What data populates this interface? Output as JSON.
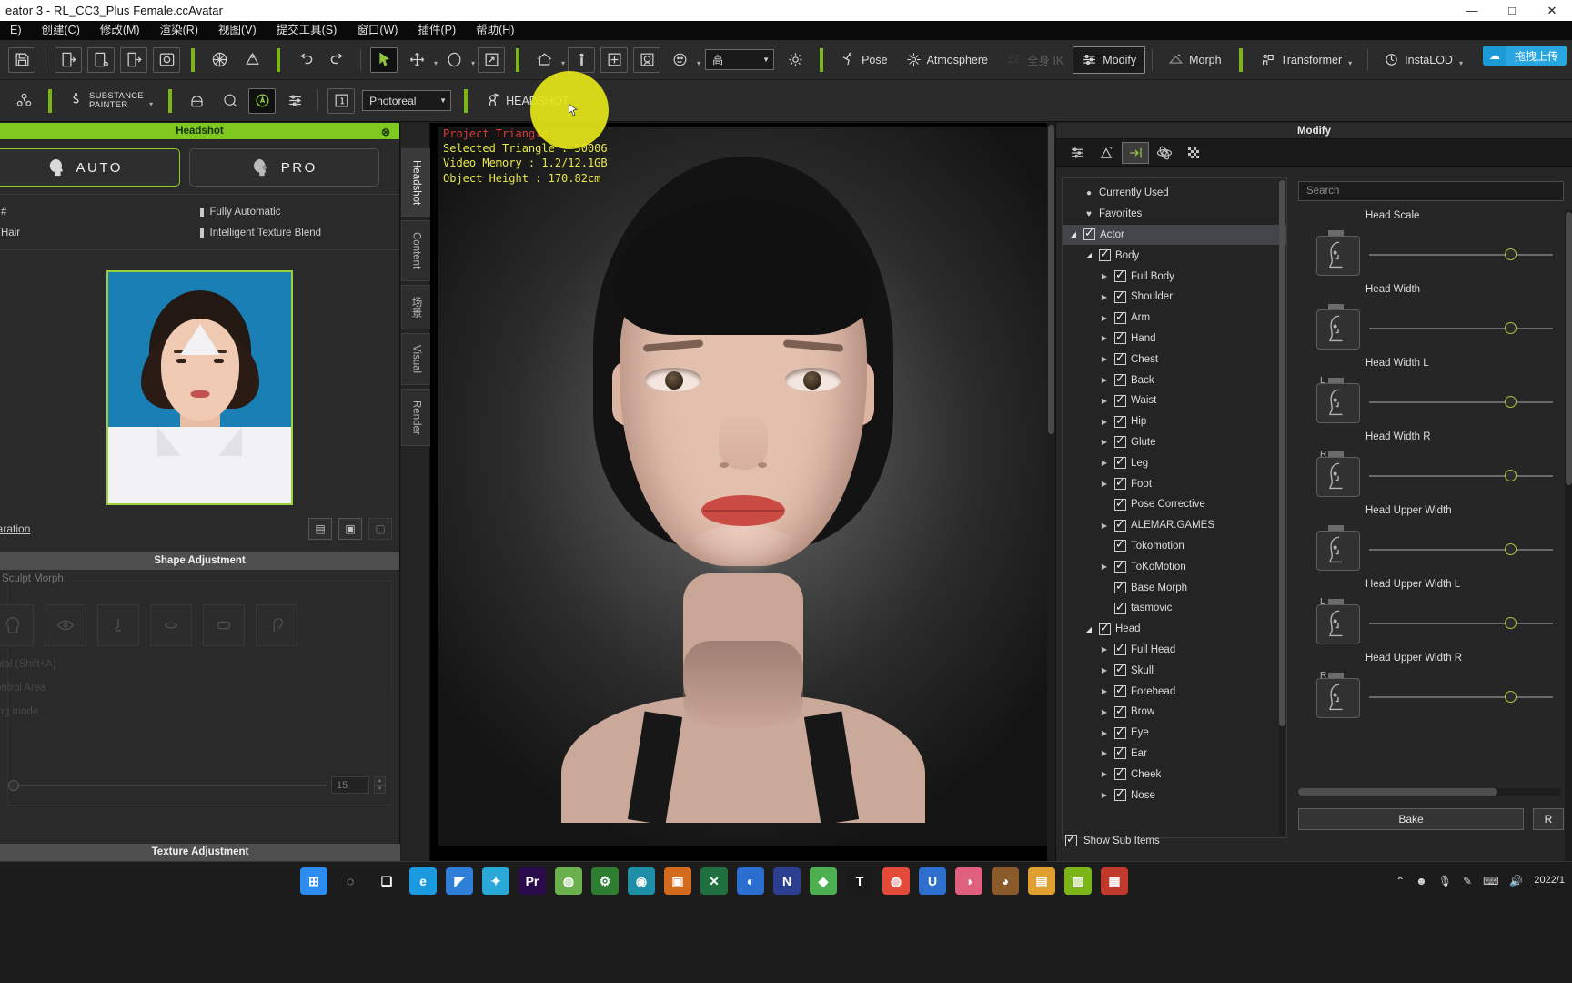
{
  "window": {
    "title": "eator 3 - RL_CC3_Plus Female.ccAvatar",
    "minimize": "—",
    "maximize": "□",
    "close": "✕"
  },
  "menubar": {
    "items": [
      {
        "label": "E)"
      },
      {
        "label": "创建(C)"
      },
      {
        "label": "修改(M)"
      },
      {
        "label": "渲染(R)"
      },
      {
        "label": "视图(V)"
      },
      {
        "label": "提交工具(S)"
      },
      {
        "label": "窗口(W)"
      },
      {
        "label": "插件(P)"
      },
      {
        "label": "帮助(H)"
      }
    ]
  },
  "upload_pill": {
    "icon": "cloud-icon",
    "label": "拖拽上传"
  },
  "toolbar_row1": {
    "save": "save-icon",
    "import_avatar": "import-avatar-icon",
    "import_prop": "import-prop-icon",
    "export": "export-icon",
    "preview": "preview-icon",
    "geometry": "geometry-icon",
    "mesh": "mesh-icon",
    "undo": "undo-icon",
    "redo": "redo-icon",
    "select": "select-arrow-icon",
    "move": "move-icon",
    "rotate": "rotate-icon",
    "scale": "scale-icon",
    "home": "home-icon",
    "fit_person": "fit-person-icon",
    "fit_all": "fit-all-icon",
    "face_view": "face-view-icon",
    "expression": "expression-icon",
    "quality_value": "高",
    "light": "light-icon",
    "pose_label": "Pose",
    "atmosphere_label": "Atmosphere",
    "disabled_label": "全身 IK",
    "modify_label": "Modify",
    "morph_label": "Morph",
    "transformer_label": "Transformer",
    "instalod_label": "InstaLOD"
  },
  "toolbar_row2": {
    "character_icon": "character-creator-icon",
    "substance_brand_top": "SUBSTANCE",
    "substance_brand_bottom": "PAINTER",
    "smart_hair": "smart-hair-icon",
    "skingen": "skingen-icon",
    "appearance": "appearance-editor-icon",
    "settings": "settings-sliders-icon",
    "frame": "frame-number-icon",
    "render_mode": "Photoreal",
    "headshot_label": "HEADSHOT"
  },
  "headshot_panel": {
    "title": "Headshot",
    "close": "⊗",
    "modes": [
      {
        "label": "AUTO",
        "icon": "auto-head-icon",
        "selected": true
      },
      {
        "label": "PRO",
        "icon": "pro-head-icon",
        "selected": false
      }
    ],
    "features_left": [
      {
        "label": "#"
      },
      {
        "label": "Hair"
      }
    ],
    "features_right": [
      {
        "label": "Fully Automatic"
      },
      {
        "label": "Intelligent Texture Blend"
      }
    ],
    "photo_name": "source-photo-thumbnail",
    "link_label": "paration",
    "action_icons": [
      {
        "name": "load-image-icon",
        "glyph": "▤"
      },
      {
        "name": "save-image-icon",
        "glyph": "▣"
      },
      {
        "name": "reset-image-icon",
        "glyph": "▢"
      }
    ],
    "shape_adjustment_title": "Shape Adjustment",
    "sculpt_morph_label": "Sculpt Morph",
    "sculpt_icons": [
      "sculpt-head-icon",
      "sculpt-eye-icon",
      "sculpt-nose-icon",
      "sculpt-mouth-icon",
      "sculpt-jaw-icon",
      "sculpt-ear-icon"
    ],
    "dim_texts": [
      "ntal (Shift+A)",
      "ontrol Area",
      "ing mode"
    ],
    "slider_value": "15",
    "texture_adjustment_title": "Texture Adjustment"
  },
  "vertical_tabs": [
    {
      "label": "Headshot",
      "selected": true
    },
    {
      "label": "Content",
      "selected": false
    },
    {
      "label": "场景",
      "selected": false
    },
    {
      "label": "Visual",
      "selected": false
    },
    {
      "label": "Render",
      "selected": false
    }
  ],
  "viewport": {
    "stats": [
      {
        "text": "Project Triangle :",
        "color": "#d93a3a"
      },
      {
        "text": "Selected Triangle : 50006",
        "color": "#e8e848"
      },
      {
        "text": "Video Memory : 1.2/12.1GB",
        "color": "#e8e848"
      },
      {
        "text": "Object Height : 170.82cm",
        "color": "#e8e848"
      }
    ],
    "avatar_name": "3d-avatar-female-head"
  },
  "modify_panel": {
    "title": "Modify",
    "icon_tabs": [
      {
        "name": "sliders-tab-icon",
        "selected": false
      },
      {
        "name": "morph-tab-icon",
        "selected": false
      },
      {
        "name": "transform-tab-icon",
        "selected": true
      },
      {
        "name": "physics-tab-icon",
        "selected": false
      },
      {
        "name": "checker-tab-icon",
        "selected": false
      }
    ],
    "tree": [
      {
        "label": "Currently Used",
        "indent": 1,
        "marker": "dot",
        "check": false,
        "arrow": ""
      },
      {
        "label": "Favorites",
        "indent": 1,
        "marker": "heart",
        "check": false,
        "arrow": ""
      },
      {
        "label": "Actor",
        "indent": 0,
        "check": true,
        "arrow": "open",
        "selected": true
      },
      {
        "label": "Body",
        "indent": 1,
        "check": true,
        "arrow": "open"
      },
      {
        "label": "Full Body",
        "indent": 2,
        "check": true,
        "arrow": "closed"
      },
      {
        "label": "Shoulder",
        "indent": 2,
        "check": true,
        "arrow": "closed"
      },
      {
        "label": "Arm",
        "indent": 2,
        "check": true,
        "arrow": "closed"
      },
      {
        "label": "Hand",
        "indent": 2,
        "check": true,
        "arrow": "closed"
      },
      {
        "label": "Chest",
        "indent": 2,
        "check": true,
        "arrow": "closed"
      },
      {
        "label": "Back",
        "indent": 2,
        "check": true,
        "arrow": "closed"
      },
      {
        "label": "Waist",
        "indent": 2,
        "check": true,
        "arrow": "closed"
      },
      {
        "label": "Hip",
        "indent": 2,
        "check": true,
        "arrow": "closed"
      },
      {
        "label": "Glute",
        "indent": 2,
        "check": true,
        "arrow": "closed"
      },
      {
        "label": "Leg",
        "indent": 2,
        "check": true,
        "arrow": "closed"
      },
      {
        "label": "Foot",
        "indent": 2,
        "check": true,
        "arrow": "closed"
      },
      {
        "label": "Pose Corrective",
        "indent": 2,
        "check": true,
        "arrow": ""
      },
      {
        "label": "ALEMAR.GAMES",
        "indent": 2,
        "check": true,
        "arrow": "closed"
      },
      {
        "label": "Tokomotion",
        "indent": 2,
        "check": true,
        "arrow": ""
      },
      {
        "label": "ToKoMotion",
        "indent": 2,
        "check": true,
        "arrow": "closed"
      },
      {
        "label": "Base Morph",
        "indent": 2,
        "check": true,
        "arrow": ""
      },
      {
        "label": "tasmovic",
        "indent": 2,
        "check": true,
        "arrow": ""
      },
      {
        "label": "Head",
        "indent": 1,
        "check": true,
        "arrow": "open"
      },
      {
        "label": "Full Head",
        "indent": 2,
        "check": true,
        "arrow": "closed"
      },
      {
        "label": "Skull",
        "indent": 2,
        "check": true,
        "arrow": "closed"
      },
      {
        "label": "Forehead",
        "indent": 2,
        "check": true,
        "arrow": "closed"
      },
      {
        "label": "Brow",
        "indent": 2,
        "check": true,
        "arrow": "closed"
      },
      {
        "label": "Eye",
        "indent": 2,
        "check": true,
        "arrow": "closed"
      },
      {
        "label": "Ear",
        "indent": 2,
        "check": true,
        "arrow": "closed"
      },
      {
        "label": "Cheek",
        "indent": 2,
        "check": true,
        "arrow": "closed"
      },
      {
        "label": "Nose",
        "indent": 2,
        "check": true,
        "arrow": "closed"
      }
    ],
    "show_sub_items": "Show Sub Items",
    "search_placeholder": "Search",
    "sliders": [
      {
        "name": "Head Scale",
        "lr": ""
      },
      {
        "name": "Head Width",
        "lr": ""
      },
      {
        "name": "Head Width L",
        "lr": "L"
      },
      {
        "name": "Head Width R",
        "lr": "R"
      },
      {
        "name": "Head Upper Width",
        "lr": ""
      },
      {
        "name": "Head Upper Width L",
        "lr": "L"
      },
      {
        "name": "Head Upper Width R",
        "lr": "R"
      }
    ],
    "buttons": [
      {
        "label": "Bake"
      },
      {
        "label": "R"
      }
    ]
  },
  "taskbar": {
    "icons": [
      {
        "name": "windows-start-icon",
        "glyph": "⊞",
        "color": "#2d8cf0"
      },
      {
        "name": "search-icon",
        "glyph": "◌",
        "color": "transparent"
      },
      {
        "name": "task-view-icon",
        "glyph": "❏",
        "color": "transparent"
      },
      {
        "name": "edge-icon",
        "glyph": "e",
        "color": "#1b9ae0"
      },
      {
        "name": "app-blue-icon",
        "glyph": "◤",
        "color": "#2f7fd8"
      },
      {
        "name": "app-teal-icon",
        "glyph": "✦",
        "color": "#2aa8d8"
      },
      {
        "name": "premiere-icon",
        "glyph": "Pr",
        "color": "#2a0a4a"
      },
      {
        "name": "chrome-alt-icon",
        "glyph": "◍",
        "color": "#6ab04c"
      },
      {
        "name": "settings-green-icon",
        "glyph": "⚙",
        "color": "#2e7d32"
      },
      {
        "name": "app-cyan-icon",
        "glyph": "◉",
        "color": "#1f8fa8"
      },
      {
        "name": "app-orange-icon",
        "glyph": "▣",
        "color": "#d46a1e"
      },
      {
        "name": "app-x-icon",
        "glyph": "✕",
        "color": "#1f6f3f"
      },
      {
        "name": "app-blue2-icon",
        "glyph": "◐",
        "color": "#2a6fd0"
      },
      {
        "name": "app-indigo-icon",
        "glyph": "N",
        "color": "#2c3e8f"
      },
      {
        "name": "app-green-icon",
        "glyph": "◆",
        "color": "#4caf50"
      },
      {
        "name": "app-dark-icon",
        "glyph": "T",
        "color": "#1a1a1a"
      },
      {
        "name": "chrome-icon",
        "glyph": "◍",
        "color": "#e34a3a"
      },
      {
        "name": "app-u-icon",
        "glyph": "U",
        "color": "#2f6fd0"
      },
      {
        "name": "app-pink-icon",
        "glyph": "◑",
        "color": "#e06080"
      },
      {
        "name": "app-brown-icon",
        "glyph": "◕",
        "color": "#8b5a2b"
      },
      {
        "name": "folder-icon",
        "glyph": "▤",
        "color": "#e0a030"
      },
      {
        "name": "app-lime-icon",
        "glyph": "▥",
        "color": "#7cb518"
      },
      {
        "name": "app-red-icon",
        "glyph": "▦",
        "color": "#c0392b"
      }
    ],
    "tray": [
      {
        "name": "chevron-up-icon",
        "glyph": "⌃"
      },
      {
        "name": "user-icon",
        "glyph": "☻"
      },
      {
        "name": "mic-icon",
        "glyph": "🎙"
      },
      {
        "name": "pin-icon",
        "glyph": "✎"
      },
      {
        "name": "keyboard-icon",
        "glyph": "⌨"
      },
      {
        "name": "volume-icon",
        "glyph": "🔊"
      },
      {
        "name": "battery-icon",
        "glyph": "▭"
      }
    ],
    "clock": "2022/1"
  }
}
